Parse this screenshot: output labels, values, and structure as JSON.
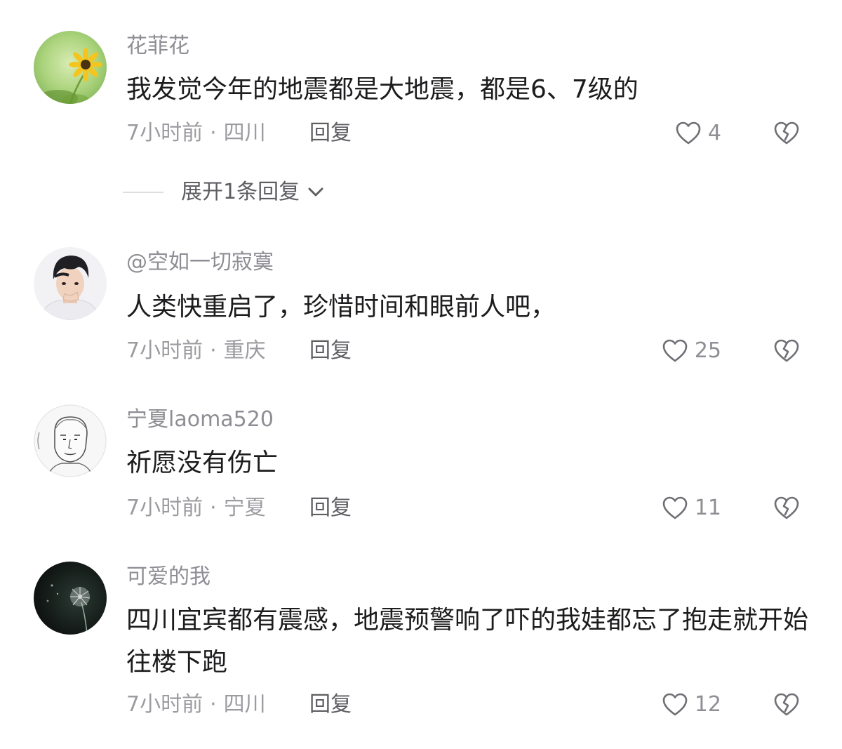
{
  "comments": [
    {
      "username": "花菲花",
      "text": "我发觉今年的地震都是大地震，都是6、7级的",
      "time": "7小时前",
      "separator": "·",
      "location": "四川",
      "reply_label": "回复",
      "likes": "4",
      "expand_label": "展开1条回复",
      "avatar": "sunflower"
    },
    {
      "username": "@空如一切寂寞",
      "text": "人类快重启了，珍惜时间和眼前人吧，",
      "time": "7小时前",
      "separator": "·",
      "location": "重庆",
      "reply_label": "回复",
      "likes": "25",
      "avatar": "young-man"
    },
    {
      "username": "宁夏laoma520",
      "text": "祈愿没有伤亡",
      "time": "7小时前",
      "separator": "·",
      "location": "宁夏",
      "reply_label": "回复",
      "likes": "11",
      "avatar": "pencil-sketch-portrait"
    },
    {
      "username": "可爱的我",
      "text": "四川宜宾都有震感，地震预警响了吓的我娃都忘了抱走就开始往楼下跑",
      "time": "7小时前",
      "separator": "·",
      "location": "四川",
      "reply_label": "回复",
      "likes": "12",
      "avatar": "dandelion-night"
    }
  ],
  "icons": {
    "like": "heart-outline-icon",
    "dislike": "broken-heart-icon",
    "expand": "chevron-down-icon"
  },
  "colors": {
    "username": "#8e8e94",
    "text": "#1c1c1e",
    "meta": "#9b9ba0",
    "reply": "#5e5e63"
  }
}
